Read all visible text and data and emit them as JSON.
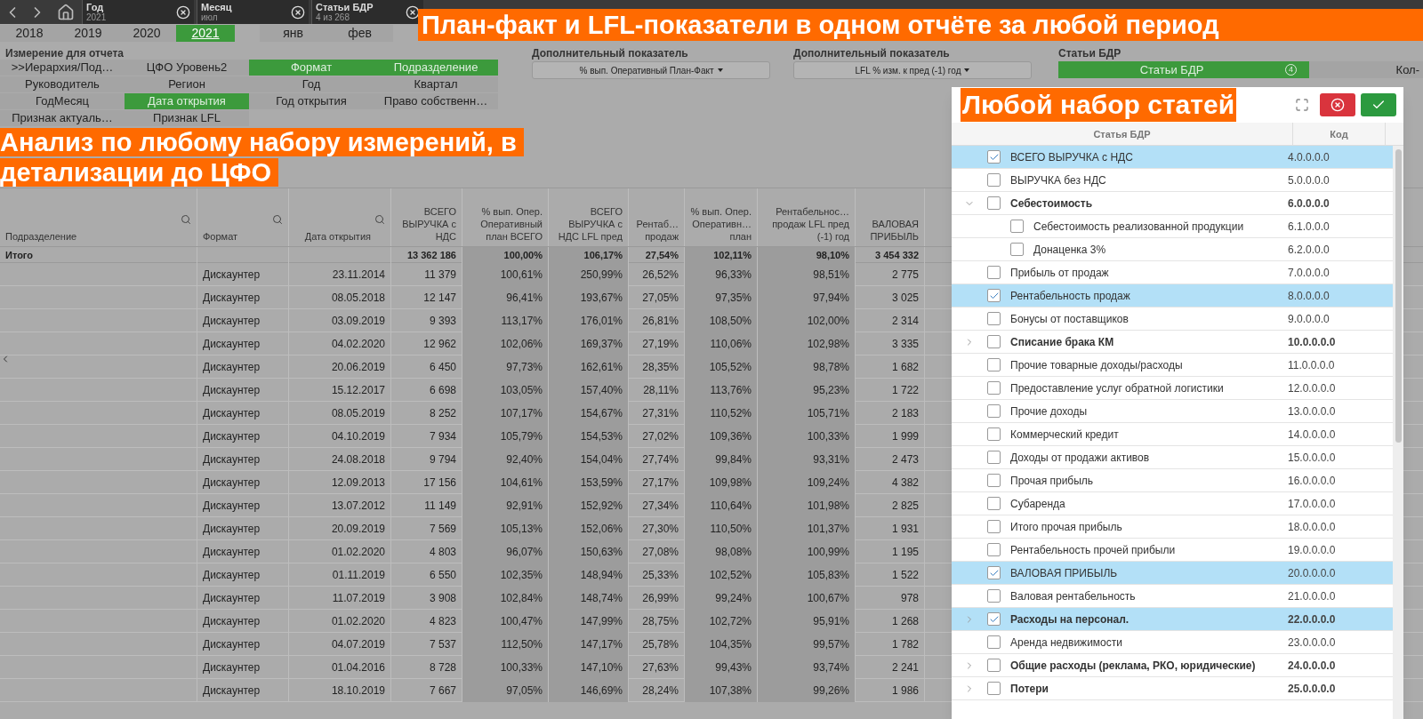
{
  "nav": {
    "filters": [
      {
        "label": "Год",
        "value": "2021"
      },
      {
        "label": "Месяц",
        "value": "июл"
      },
      {
        "label": "Статьи БДР",
        "value": "4 из 268"
      }
    ]
  },
  "banner_top": "План-факт и LFL-показатели в одном отчёте за любой период",
  "years": [
    {
      "label": "2018",
      "selected": false
    },
    {
      "label": "2019",
      "selected": false
    },
    {
      "label": "2020",
      "selected": false
    },
    {
      "label": "2021",
      "selected": true
    }
  ],
  "months": [
    {
      "label": "янв",
      "selected": false
    },
    {
      "label": "фев",
      "selected": false
    }
  ],
  "dimensions": {
    "title": "Измерение для отчета",
    "items": [
      {
        "label": ">>Иерархия/Под…",
        "selected": false
      },
      {
        "label": "ЦФО Уровень2",
        "selected": false
      },
      {
        "label": "Формат",
        "selected": true
      },
      {
        "label": "Подразделение",
        "selected": true
      },
      {
        "label": "Руководитель",
        "selected": false
      },
      {
        "label": "Регион",
        "selected": false
      },
      {
        "label": "Год",
        "selected": false
      },
      {
        "label": "Квартал",
        "selected": false
      },
      {
        "label": "ГодМесяц",
        "selected": false
      },
      {
        "label": "Дата открытия",
        "selected": true
      },
      {
        "label": "Год открытия",
        "selected": false
      },
      {
        "label": "Право собственн…",
        "selected": false
      },
      {
        "label": "Признак актуаль…",
        "selected": false
      },
      {
        "label": "Признак LFL",
        "selected": false
      }
    ]
  },
  "extra_metrics": [
    {
      "title": "Дополнительный показатель",
      "value": "% вып. Оперативный План-Факт"
    },
    {
      "title": "Дополнительный показатель",
      "value": "LFL % изм. к пред (-1) год"
    }
  ],
  "articles": {
    "title": "Статьи БДР",
    "button": "Статьи БДР",
    "count": "4",
    "side_button": "Кол-"
  },
  "banner_left": [
    "Анализ по любому набору измерений, в",
    "детализации до ЦФО"
  ],
  "table": {
    "columns": [
      {
        "label": "Подразделение",
        "search": true
      },
      {
        "label": "Формат",
        "search": true
      },
      {
        "label": "Дата открытия",
        "search": true
      },
      {
        "label": "ВСЕГО ВЫРУЧКА с НДС",
        "search": false
      },
      {
        "label": "% вып. Опер. Оперативный план ВСЕГО",
        "search": false
      },
      {
        "label": "ВСЕГО ВЫРУЧКА с НДС LFL пред",
        "search": false
      },
      {
        "label": "Рентаб… продаж",
        "search": false
      },
      {
        "label": "% вып. Опер. Оперативн… план",
        "search": false
      },
      {
        "label": "Рентабельнос… продаж LFL пред (-1) год",
        "search": false
      },
      {
        "label": "ВАЛОВАЯ ПРИБЫЛЬ",
        "search": false
      }
    ],
    "value_bands": [
      {
        "shaded": false
      },
      {
        "shaded": true
      },
      {
        "shaded": true
      },
      {
        "shaded": false
      },
      {
        "shaded": true
      },
      {
        "shaded": true
      },
      {
        "shaded": false
      }
    ],
    "total": {
      "label": "Итого",
      "values": [
        "13 362 186",
        "100,00%",
        "106,17%",
        "27,54%",
        "102,11%",
        "98,10%",
        "3 454 332"
      ]
    },
    "rows": [
      [
        "",
        "Дискаунтер",
        "23.11.2014",
        "11 379",
        "100,61%",
        "250,99%",
        "26,52%",
        "96,33%",
        "98,51%",
        "2 775"
      ],
      [
        "",
        "Дискаунтер",
        "08.05.2018",
        "12 147",
        "96,41%",
        "193,67%",
        "27,05%",
        "97,35%",
        "97,94%",
        "3 025"
      ],
      [
        "",
        "Дискаунтер",
        "03.09.2019",
        "9 393",
        "113,17%",
        "176,01%",
        "26,81%",
        "108,50%",
        "102,00%",
        "2 314"
      ],
      [
        "",
        "Дискаунтер",
        "04.02.2020",
        "12 962",
        "102,06%",
        "169,37%",
        "27,19%",
        "110,06%",
        "102,98%",
        "3 335"
      ],
      [
        "",
        "Дискаунтер",
        "20.06.2019",
        "6 450",
        "97,73%",
        "162,61%",
        "28,35%",
        "105,52%",
        "98,78%",
        "1 682"
      ],
      [
        "",
        "Дискаунтер",
        "15.12.2017",
        "6 698",
        "103,05%",
        "157,40%",
        "28,11%",
        "113,76%",
        "95,23%",
        "1 722"
      ],
      [
        "",
        "Дискаунтер",
        "08.05.2019",
        "8 252",
        "107,17%",
        "154,67%",
        "27,31%",
        "110,52%",
        "105,71%",
        "2 183"
      ],
      [
        "",
        "Дискаунтер",
        "04.10.2019",
        "7 934",
        "105,79%",
        "154,53%",
        "27,02%",
        "109,36%",
        "100,33%",
        "1 999"
      ],
      [
        "",
        "Дискаунтер",
        "24.08.2018",
        "9 794",
        "92,40%",
        "154,04%",
        "27,74%",
        "99,84%",
        "93,31%",
        "2 473"
      ],
      [
        "",
        "Дискаунтер",
        "12.09.2013",
        "17 156",
        "104,61%",
        "153,59%",
        "27,17%",
        "109,98%",
        "109,24%",
        "4 382"
      ],
      [
        "",
        "Дискаунтер",
        "13.07.2012",
        "11 149",
        "92,91%",
        "152,92%",
        "27,34%",
        "110,64%",
        "101,98%",
        "2 825"
      ],
      [
        "",
        "Дискаунтер",
        "20.09.2019",
        "7 569",
        "105,13%",
        "152,06%",
        "27,30%",
        "110,50%",
        "101,37%",
        "1 931"
      ],
      [
        "",
        "Дискаунтер",
        "01.02.2020",
        "4 803",
        "96,07%",
        "150,63%",
        "27,08%",
        "98,08%",
        "100,99%",
        "1 195"
      ],
      [
        "",
        "Дискаунтер",
        "01.11.2019",
        "6 550",
        "102,35%",
        "148,94%",
        "25,33%",
        "102,52%",
        "105,83%",
        "1 522"
      ],
      [
        "",
        "Дискаунтер",
        "11.07.2019",
        "3 908",
        "102,84%",
        "148,74%",
        "26,99%",
        "99,24%",
        "100,67%",
        "978"
      ],
      [
        "",
        "Дискаунтер",
        "01.02.2020",
        "4 823",
        "100,47%",
        "147,99%",
        "28,75%",
        "102,72%",
        "95,91%",
        "1 268"
      ],
      [
        "",
        "Дискаунтер",
        "04.07.2019",
        "7 537",
        "112,50%",
        "147,17%",
        "25,78%",
        "104,35%",
        "99,57%",
        "1 782"
      ],
      [
        "",
        "Дискаунтер",
        "01.04.2016",
        "8 728",
        "100,33%",
        "147,10%",
        "27,63%",
        "99,43%",
        "93,74%",
        "2 241"
      ],
      [
        "",
        "Дискаунтер",
        "18.10.2019",
        "7 667",
        "97,05%",
        "146,69%",
        "28,24%",
        "107,38%",
        "99,26%",
        "1 986"
      ]
    ]
  },
  "popup": {
    "title": "Любой набор статей",
    "columns": [
      "Статья БДР",
      "Код"
    ],
    "items": [
      {
        "label": "ВСЕГО ВЫРУЧКА с НДС",
        "code": "4.0.0.0.0",
        "checked": true
      },
      {
        "label": "ВЫРУЧКА без НДС",
        "code": "5.0.0.0.0",
        "checked": false
      },
      {
        "label": "Себестоимость",
        "code": "6.0.0.0.0",
        "checked": false,
        "expanded": true,
        "children": [
          {
            "label": "Себестоимость реализованной продукции",
            "code": "6.1.0.0.0",
            "checked": false
          },
          {
            "label": "Донаценка 3%",
            "code": "6.2.0.0.0",
            "checked": false
          }
        ]
      },
      {
        "label": "Прибыль от продаж",
        "code": "7.0.0.0.0",
        "checked": false
      },
      {
        "label": "Рентабельность продаж",
        "code": "8.0.0.0.0",
        "checked": true
      },
      {
        "label": "Бонусы от поставщиков",
        "code": "9.0.0.0.0",
        "checked": false
      },
      {
        "label": "Списание брака КМ",
        "code": "10.0.0.0.0",
        "checked": false,
        "expanded": false
      },
      {
        "label": "Прочие товарные доходы/расходы",
        "code": "11.0.0.0.0",
        "checked": false
      },
      {
        "label": "Предоставление услуг обратной логистики",
        "code": "12.0.0.0.0",
        "checked": false
      },
      {
        "label": "Прочие доходы",
        "code": "13.0.0.0.0",
        "checked": false
      },
      {
        "label": "Коммерческий кредит",
        "code": "14.0.0.0.0",
        "checked": false
      },
      {
        "label": "Доходы от продажи активов",
        "code": "15.0.0.0.0",
        "checked": false
      },
      {
        "label": "Прочая прибыль",
        "code": "16.0.0.0.0",
        "checked": false
      },
      {
        "label": "Субаренда",
        "code": "17.0.0.0.0",
        "checked": false
      },
      {
        "label": "Итого прочая прибыль",
        "code": "18.0.0.0.0",
        "checked": false
      },
      {
        "label": "Рентабельность прочей прибыли",
        "code": "19.0.0.0.0",
        "checked": false
      },
      {
        "label": "ВАЛОВАЯ ПРИБЫЛЬ",
        "code": "20.0.0.0.0",
        "checked": true
      },
      {
        "label": "Валовая рентабельность",
        "code": "21.0.0.0.0",
        "checked": false
      },
      {
        "label": "Расходы на персонал.",
        "code": "22.0.0.0.0",
        "checked": true,
        "expanded": false
      },
      {
        "label": "Аренда недвижимости",
        "code": "23.0.0.0.0",
        "checked": false
      },
      {
        "label": "Общие расходы (реклама, РКО, юридические)",
        "code": "24.0.0.0.0",
        "checked": false,
        "expanded": false
      },
      {
        "label": "Потери",
        "code": "25.0.0.0.0",
        "checked": false,
        "expanded": false
      }
    ]
  }
}
